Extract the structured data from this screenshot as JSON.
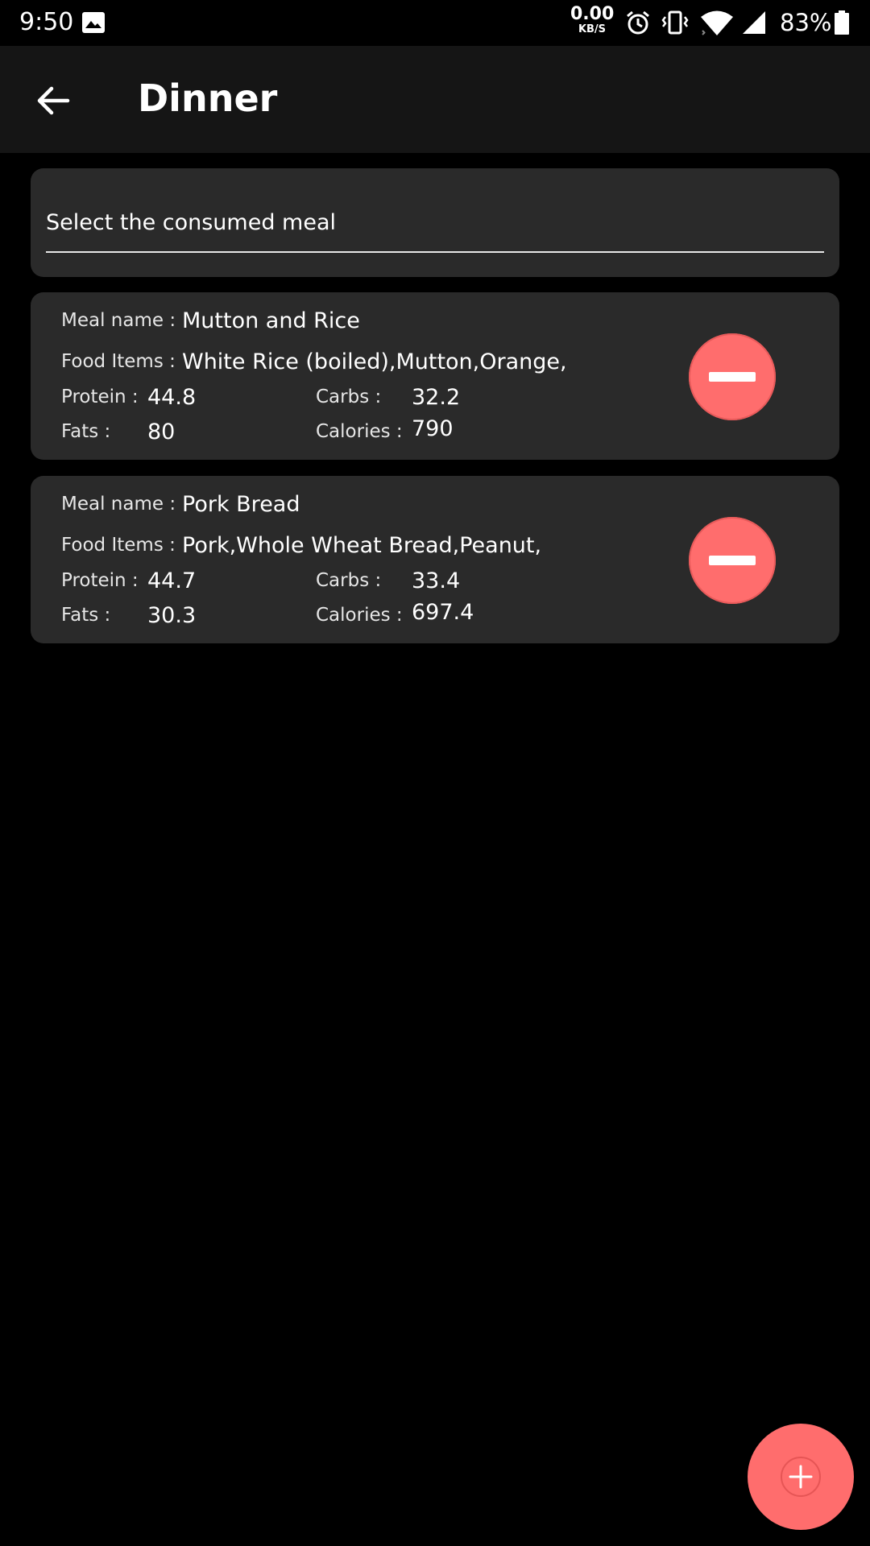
{
  "status_bar": {
    "time": "9:50",
    "net_speed_value": "0.00",
    "net_speed_unit": "KB/S",
    "battery_percent": "83%",
    "icons": [
      "image-icon",
      "alarm-icon",
      "vibrate-icon",
      "wifi-icon",
      "cell-signal-icon",
      "battery-icon"
    ]
  },
  "app_bar": {
    "title": "Dinner",
    "back_icon": "arrow-left-icon"
  },
  "select_meal": {
    "label": "Select the consumed meal"
  },
  "labels": {
    "meal_name": "Meal name :",
    "food_items": "Food Items :",
    "protein": "Protein :",
    "carbs": "Carbs :",
    "fats": "Fats :",
    "calories": "Calories :"
  },
  "meals": [
    {
      "name": "Mutton and Rice",
      "food_items": "White Rice (boiled),Mutton,Orange,",
      "protein": "44.8",
      "carbs": "32.2",
      "fats": "80",
      "calories": "790"
    },
    {
      "name": "Pork Bread",
      "food_items": "Pork,Whole Wheat Bread,Peanut,",
      "protein": "44.7",
      "carbs": "33.4",
      "fats": "30.3",
      "calories": "697.4"
    }
  ],
  "colors": {
    "accent": "#ff6d6d",
    "card": "#2a2a2a",
    "app_bar": "#151515",
    "background": "#000000"
  },
  "fab_icon": "plus-icon",
  "remove_icon": "minus-icon"
}
